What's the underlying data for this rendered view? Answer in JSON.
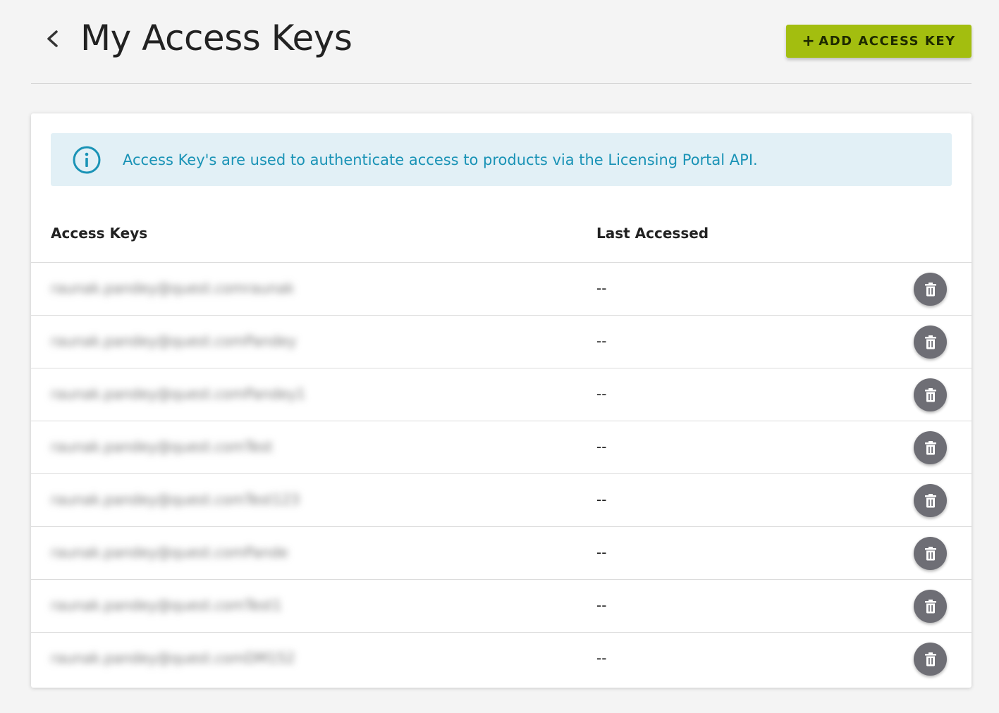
{
  "header": {
    "title": "My Access Keys",
    "add_button_plus": "+",
    "add_button_label": "ADD ACCESS KEY"
  },
  "banner": {
    "text": "Access Key's are used to authenticate access to products via the Licensing Portal API."
  },
  "table": {
    "columns": {
      "key": "Access Keys",
      "last_accessed": "Last Accessed"
    },
    "rows": [
      {
        "key": "raunak.pandey@quest.comraunak",
        "last_accessed": "--"
      },
      {
        "key": "raunak.pandey@quest.comPandey",
        "last_accessed": "--"
      },
      {
        "key": "raunak.pandey@quest.comPandey1",
        "last_accessed": "--"
      },
      {
        "key": "raunak.pandey@quest.comTest",
        "last_accessed": "--"
      },
      {
        "key": "raunak.pandey@quest.comTest123",
        "last_accessed": "--"
      },
      {
        "key": "raunak.pandey@quest.comPande",
        "last_accessed": "--"
      },
      {
        "key": "raunak.pandey@quest.comTest1",
        "last_accessed": "--"
      },
      {
        "key": "raunak.pandey@quest.comDM152",
        "last_accessed": "--"
      }
    ]
  },
  "icons": {
    "back": "chevron-left-icon",
    "info": "info-icon",
    "delete": "trash-icon"
  },
  "colors": {
    "accent": "#a3be0f",
    "info_text": "#1a93b6",
    "info_bg": "#e2f0f6",
    "delete_bg": "#6e6e75"
  }
}
